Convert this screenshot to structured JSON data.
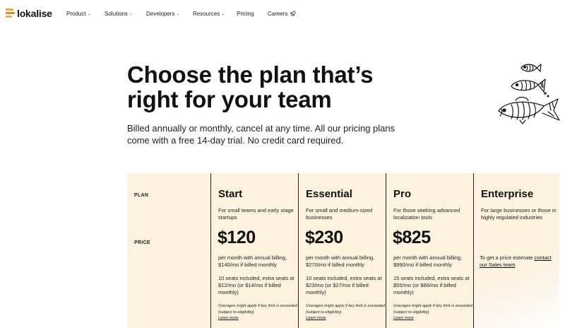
{
  "nav": {
    "logo": "lokalise",
    "items": [
      {
        "label": "Product",
        "dropdown": true
      },
      {
        "label": "Solutions",
        "dropdown": true
      },
      {
        "label": "Developers",
        "dropdown": true
      },
      {
        "label": "Resources",
        "dropdown": true
      },
      {
        "label": "Pricing",
        "dropdown": false
      },
      {
        "label": "Careers",
        "icon": "rocket-icon"
      }
    ]
  },
  "hero": {
    "title_lines": [
      "Choose the plan that’s",
      "right for your team"
    ],
    "subtitle_lines": [
      "Billed annually or monthly, cancel at any time. All our pricing plans",
      "come with a free 14-day trial. No credit card required."
    ]
  },
  "pricing": {
    "row_labels": {
      "plan": "PLAN",
      "price": "PRICE"
    },
    "plans": [
      {
        "name": "Start",
        "description": "For small teams and early stage startups",
        "price": "$120",
        "billing": "per month with annual billing, $140/mo if billed monthly",
        "seats": "10 seats included, extra seats at $12/mo (or $14/mo if billed monthly)",
        "overage": "Overages might apply if key limit is exceeded (subject to eligibility).",
        "learn_more": "Learn more"
      },
      {
        "name": "Essential",
        "description": "For small and medium-sized businesses",
        "price": "$230",
        "billing": "per month with annual billing, $270/mo if billed monthly",
        "seats": "10 seats included, extra seats at $23/mo (or $27/mo if billed monthly)",
        "overage": "Overages might apply if key limit is exceeded (subject to eligibility).",
        "learn_more": "Learn more"
      },
      {
        "name": "Pro",
        "description": "For those seeking advanced localization tools",
        "price": "$825",
        "billing": "per month with annual billing, $990/mo if billed monthly",
        "seats": "15 seats included, extra seats at $55/mo (or $66/mo if billed monthly)",
        "overage": "Overages might apply if key limit is exceeded (subject to eligibility).",
        "learn_more": "Learn more"
      }
    ],
    "enterprise": {
      "name": "Enterprise",
      "description": "For large businesses or those in highly regulated industries",
      "note_prefix": "To get a price estimate ",
      "note_link": "contact our Sales team"
    }
  },
  "colors": {
    "table_bg": "#fdf2de",
    "logo_orange": "#f5a623",
    "text": "#111111"
  }
}
